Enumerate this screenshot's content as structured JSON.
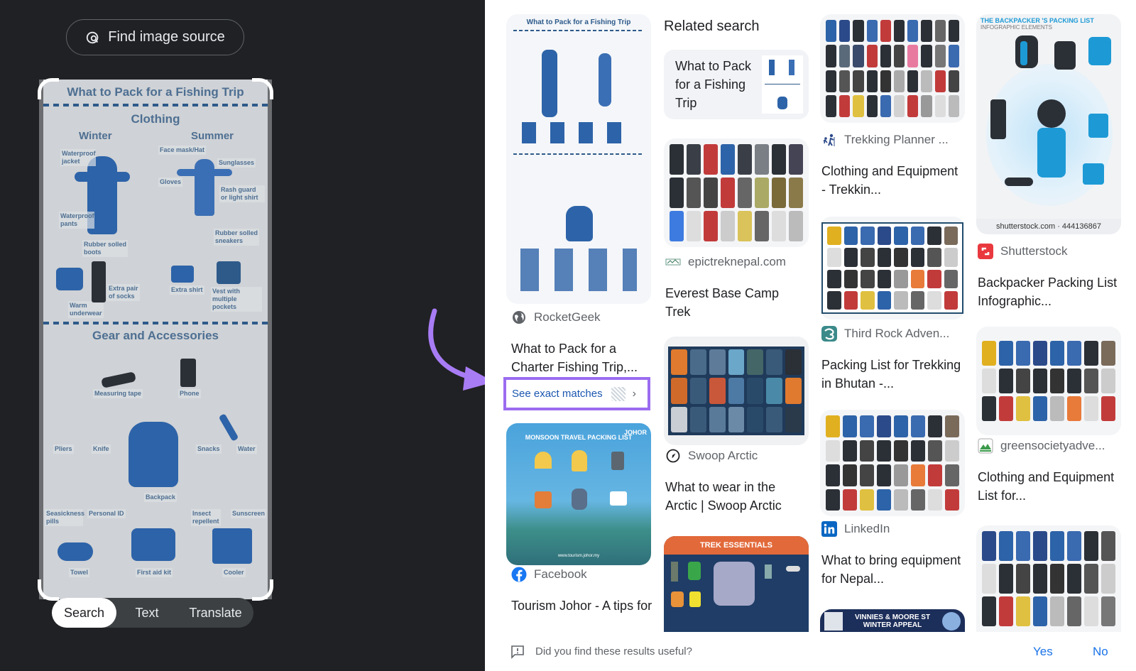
{
  "left_panel": {
    "find_source_label": "Find image source",
    "preview": {
      "title": "What to Pack for a Fishing Trip",
      "clothing_heading": "Clothing",
      "winter_heading": "Winter",
      "summer_heading": "Summer",
      "winter_labels": [
        "Waterproof jacket",
        "Waterproof pants",
        "Rubber solled boots",
        "Warm underwear",
        "Extra pair of socks"
      ],
      "summer_labels": [
        "Face mask/Hat",
        "Sunglasses",
        "Gloves",
        "Rash guard or light shirt",
        "Rubber solled sneakers",
        "Extra shirt",
        "Vest with multiple pockets"
      ],
      "gear_heading": "Gear and Accessories",
      "gear_labels": [
        "Measuring tape",
        "Phone",
        "Pliers",
        "Knife",
        "Snacks",
        "Water",
        "Backpack",
        "Seasickness pills",
        "Personal ID",
        "Insect repellent",
        "Sunscreen",
        "Towel",
        "First aid kit",
        "Cooler"
      ]
    },
    "mode_tabs": [
      {
        "label": "Search",
        "active": true
      },
      {
        "label": "Text",
        "active": false
      },
      {
        "label": "Translate",
        "active": false
      }
    ]
  },
  "results": {
    "col1": [
      {
        "thumb_title": "What to Pack for a Fishing Trip",
        "source": "RocketGeek",
        "source_icon": "globe-icon",
        "title": "What to Pack for a Charter Fishing Trip,...",
        "exact_matches_label": "See exact matches"
      },
      {
        "thumb_title": "MONSOON TRAVEL PACKING LIST",
        "thumb_brand": "JOHOR",
        "thumb_url": "www.tourism.johor.my",
        "source": "Facebook",
        "source_icon": "facebook-icon",
        "title": "Tourism Johor - A tips for monsoon travel"
      }
    ],
    "related": {
      "heading": "Related search",
      "card_label": "What to Pack for a Fishing Trip"
    },
    "col2": [
      {
        "source": "epictreknepal.com",
        "source_icon": "epictreknepal-icon",
        "title": "Everest Base Camp Trek"
      },
      {
        "source": "Swoop Arctic",
        "source_icon": "compass-icon",
        "title": "What to wear in the Arctic | Swoop Arctic"
      },
      {
        "thumb_title": "TREK ESSENTIALS"
      }
    ],
    "col3": [
      {
        "source": "Trekking Planner ...",
        "source_icon": "hikers-icon",
        "title": "Clothing and Equipment - Trekkin..."
      },
      {
        "source": "Third Rock Adven...",
        "source_icon": "third-rock-icon",
        "title": "Packing List for Trekking in Bhutan -..."
      },
      {
        "source": "LinkedIn",
        "source_icon": "linkedin-icon",
        "title": "What to bring equipment for Nepal..."
      },
      {
        "thumb_title": "VINNIES & MOORE ST WINTER APPEAL"
      }
    ],
    "col4": [
      {
        "thumb_title": "THE BACKPACKER 'S PACKING LIST",
        "thumb_subtitle": "INFOGRAPHIC ELEMENTS",
        "thumb_caption": "shutterstock.com · 444136867",
        "source": "Shutterstock",
        "source_icon": "shutterstock-icon",
        "title": "Backpacker Packing List Infographic..."
      },
      {
        "source": "greensocietyadve...",
        "source_icon": "mountain-icon",
        "title": "Clothing and Equipment List for..."
      }
    ]
  },
  "feedback": {
    "question": "Did you find these results useful?",
    "yes_label": "Yes",
    "no_label": "No"
  },
  "colors": {
    "dark_bg": "#202124",
    "highlight": "#9b6cf0",
    "link_blue": "#1a73e8"
  }
}
